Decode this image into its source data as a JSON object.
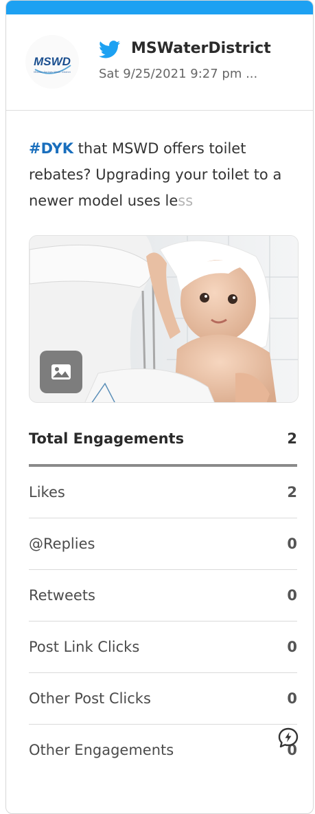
{
  "post": {
    "account_name": "MSWaterDistrict",
    "datetime": "Sat 9/25/2021 9:27 pm ...",
    "hashtag": "#DYK",
    "text_main": " that MSWD offers toilet rebates? Upgrading your toilet to a newer model uses le",
    "text_faded": "ss",
    "logo_text": "MSWD",
    "logo_subtext": "Mission Springs Water District"
  },
  "stats": {
    "total": {
      "label": "Total Engagements",
      "value": "2"
    },
    "rows": [
      {
        "label": "Likes",
        "value": "2"
      },
      {
        "label": "@Replies",
        "value": "0"
      },
      {
        "label": "Retweets",
        "value": "0"
      },
      {
        "label": "Post Link Clicks",
        "value": "0"
      },
      {
        "label": "Other Post Clicks",
        "value": "0"
      },
      {
        "label": "Other Engagements",
        "value": "0"
      }
    ]
  },
  "colors": {
    "accent": "#1da1f2",
    "hashtag": "#1a6fbd"
  },
  "icons": {
    "brand": "twitter-bird-icon",
    "media": "image-icon",
    "footer": "lightning-bubble-icon"
  }
}
